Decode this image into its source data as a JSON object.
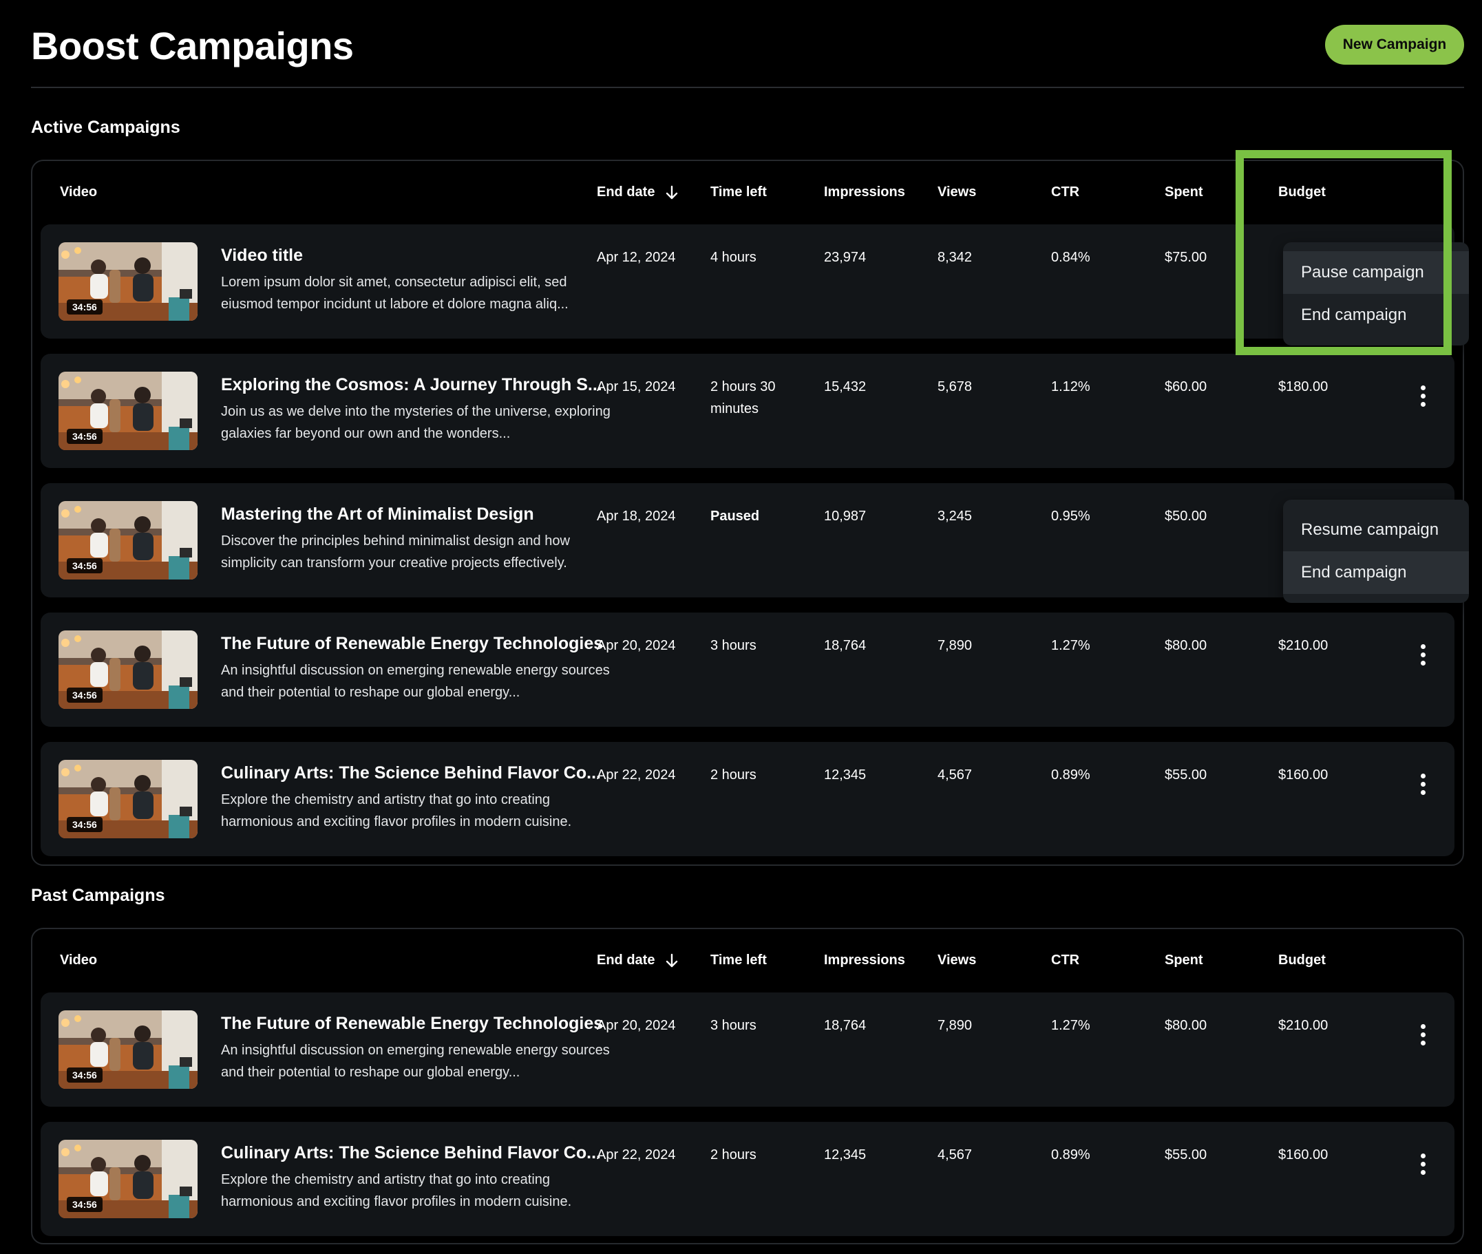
{
  "page": {
    "title": "Boost Campaigns",
    "new_campaign_label": "New Campaign"
  },
  "columns": {
    "video": "Video",
    "end_date": "End date",
    "time_left": "Time left",
    "impressions": "Impressions",
    "views": "Views",
    "ctr": "CTR",
    "spent": "Spent",
    "budget": "Budget"
  },
  "active": {
    "title": "Active Campaigns",
    "rows": [
      {
        "duration": "34:56",
        "title": "Video title",
        "desc": "Lorem ipsum dolor sit amet, consectetur adipisci elit, sed eiusmod tempor incidunt ut labore et dolore magna aliq...",
        "end_date": "Apr 12, 2024",
        "time_left": "4 hours",
        "impressions": "23,974",
        "views": "8,342",
        "ctr": "0.84%",
        "spent": "$75.00",
        "budget": ""
      },
      {
        "duration": "34:56",
        "title": "Exploring the Cosmos: A Journey Through S...",
        "desc": "Join us as we delve into the mysteries of the universe, exploring galaxies far beyond our own and the wonders...",
        "end_date": "Apr 15, 2024",
        "time_left": "2 hours 30 minutes",
        "impressions": "15,432",
        "views": "5,678",
        "ctr": "1.12%",
        "spent": "$60.00",
        "budget": "$180.00"
      },
      {
        "duration": "34:56",
        "title": "Mastering the Art of Minimalist Design",
        "desc": "Discover the principles behind minimalist design and how simplicity can transform your creative projects effectively.",
        "end_date": "Apr 18, 2024",
        "time_left": "Paused",
        "impressions": "10,987",
        "views": "3,245",
        "ctr": "0.95%",
        "spent": "$50.00",
        "budget": ""
      },
      {
        "duration": "34:56",
        "title": "The Future of Renewable Energy Technologies",
        "desc": "An insightful discussion on emerging renewable energy sources and their potential to reshape our global energy...",
        "end_date": "Apr 20, 2024",
        "time_left": "3 hours",
        "impressions": "18,764",
        "views": "7,890",
        "ctr": "1.27%",
        "spent": "$80.00",
        "budget": "$210.00"
      },
      {
        "duration": "34:56",
        "title": "Culinary Arts: The Science Behind Flavor Co...",
        "desc": "Explore the chemistry and artistry that go into creating harmonious and exciting flavor profiles in modern cuisine.",
        "end_date": "Apr 22, 2024",
        "time_left": "2 hours",
        "impressions": "12,345",
        "views": "4,567",
        "ctr": "0.89%",
        "spent": "$55.00",
        "budget": "$160.00"
      }
    ],
    "menu_row1": [
      "Pause campaign",
      "End campaign"
    ],
    "menu_row3": [
      "Resume campaign",
      "End campaign"
    ]
  },
  "past": {
    "title": "Past Campaigns",
    "rows": [
      {
        "duration": "34:56",
        "title": "The Future of Renewable Energy Technologies",
        "desc": "An insightful discussion on emerging renewable energy sources and their potential to reshape our global energy...",
        "end_date": "Apr 20, 2024",
        "time_left": "3 hours",
        "impressions": "18,764",
        "views": "7,890",
        "ctr": "1.27%",
        "spent": "$80.00",
        "budget": "$210.00"
      },
      {
        "duration": "34:56",
        "title": "Culinary Arts: The Science Behind Flavor Co...",
        "desc": "Explore the chemistry and artistry that go into creating harmonious and exciting flavor profiles in modern cuisine.",
        "end_date": "Apr 22, 2024",
        "time_left": "2 hours",
        "impressions": "12,345",
        "views": "4,567",
        "ctr": "0.89%",
        "spent": "$55.00",
        "budget": "$160.00"
      }
    ]
  },
  "colors": {
    "accent": "#8bc34a",
    "highlight": "#7ac143",
    "row_bg": "#121518",
    "menu_bg": "#1c2024"
  },
  "icons": {
    "sort": "arrow-down-icon",
    "more": "more-vertical-icon"
  }
}
